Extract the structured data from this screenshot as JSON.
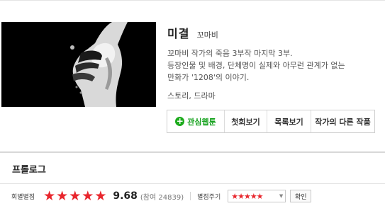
{
  "comic": {
    "title": "미결",
    "author": "꼬마비",
    "description": [
      "꼬마비 작가의 죽음 3부작 마지막 3부.",
      "등장인물 및 배경, 단체명이 실제와 아무런 관계가 없는",
      "만화가 '1208'의 이야기."
    ],
    "genre": "스토리, 드라마"
  },
  "actions": {
    "favorite": "관심웹툰",
    "first_episode": "첫회보기",
    "list": "목록보기",
    "other_works": "작가의 다른 작품"
  },
  "episode": {
    "title": "프롤로그"
  },
  "rating": {
    "label": "회별별점",
    "score": "9.68",
    "participants": "(참여 24839)",
    "stars_filled": 5,
    "rate_label": "별점주기",
    "rate_value": "★★★★★",
    "confirm": "확인"
  },
  "colors": {
    "accent_green": "#1dab1d",
    "star_red": "#e8262d"
  }
}
